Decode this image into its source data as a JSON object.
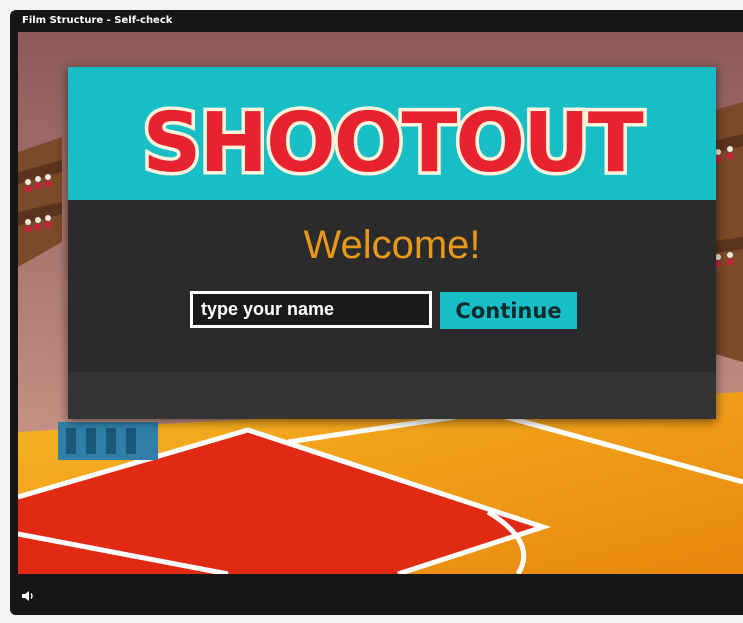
{
  "window": {
    "title": "Film Structure - Self-check"
  },
  "game": {
    "logo_text": "SHOOTOUT",
    "welcome": "Welcome!",
    "name_placeholder": "type your name",
    "name_value": "",
    "continue_label": "Continue"
  },
  "controls": {
    "volume_icon": "speaker-icon"
  },
  "colors": {
    "banner": "#17bec6",
    "modal": "#2b2b2b",
    "welcome_text": "#e8981a",
    "button": "#17bec6",
    "logo_fill": "#e8232f",
    "court_orange": "#f3a11a",
    "court_red": "#e02a14"
  }
}
